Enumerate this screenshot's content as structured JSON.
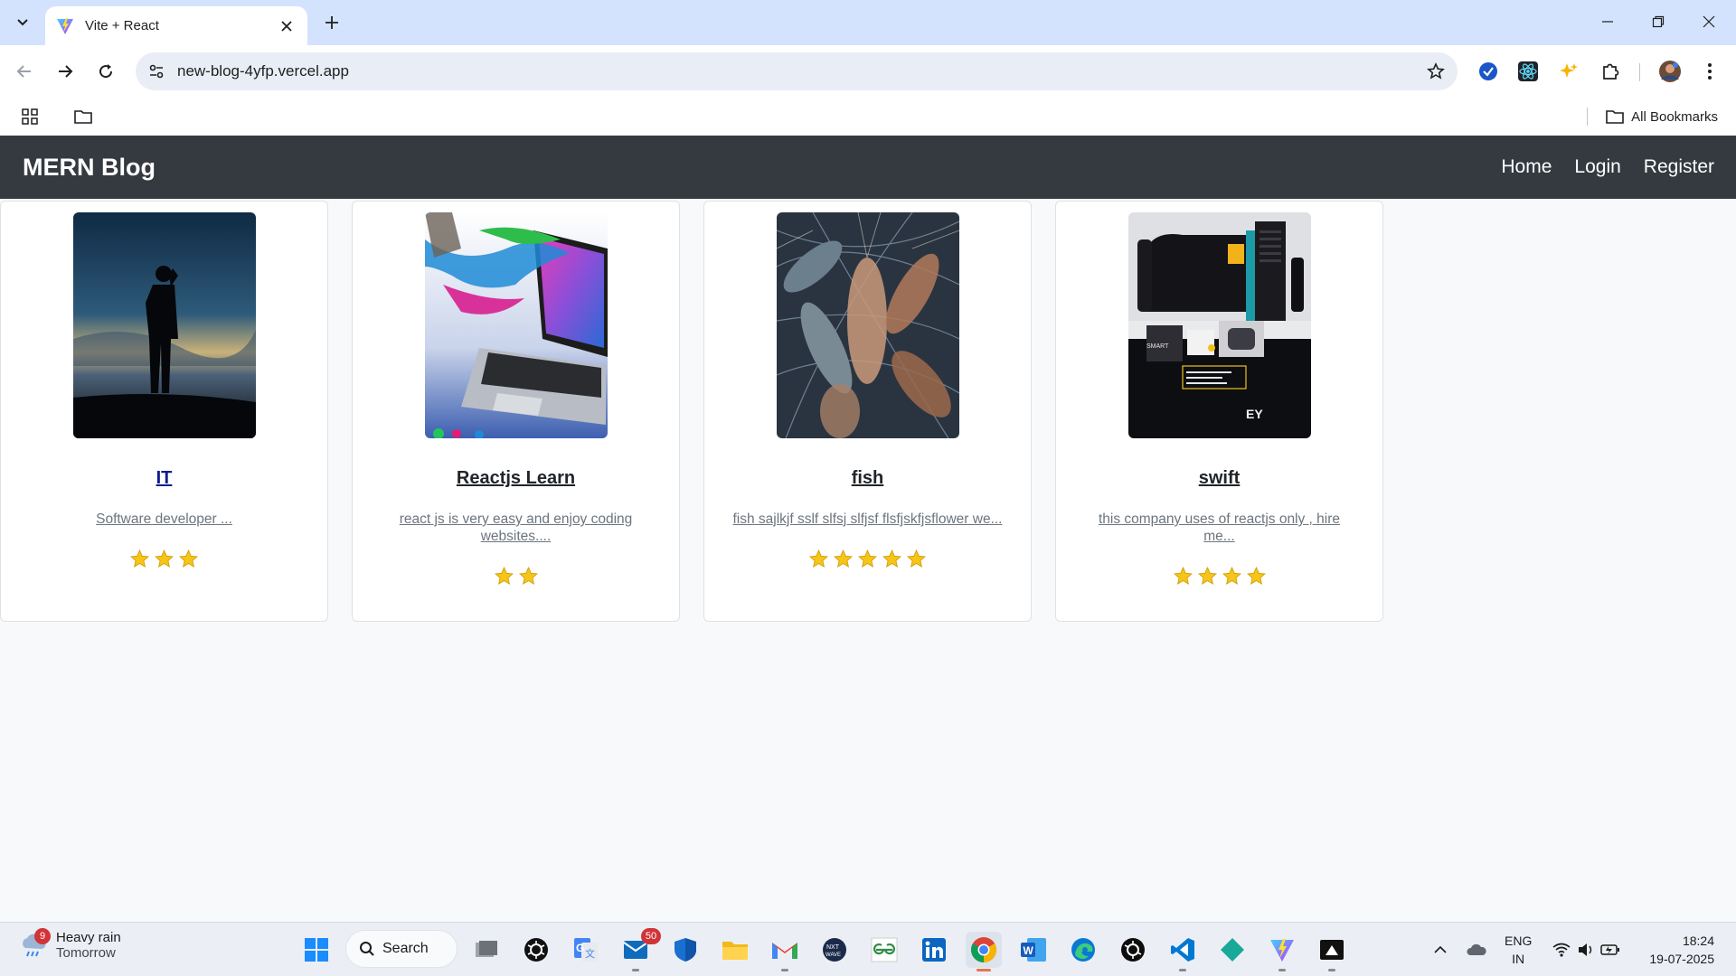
{
  "browser": {
    "tab_title": "Vite + React",
    "url": "new-blog-4yfp.vercel.app",
    "all_bookmarks_label": "All Bookmarks"
  },
  "app": {
    "brand": "MERN Blog",
    "nav": {
      "home": "Home",
      "login": "Login",
      "register": "Register"
    }
  },
  "posts": [
    {
      "title": "IT",
      "description": "Software developer ...",
      "rating": 3,
      "image": "silhouette-sunset"
    },
    {
      "title": "Reactjs Learn",
      "description": "react js is very easy and enjoy coding websites....",
      "rating": 2,
      "image": "laptop-paint-splash"
    },
    {
      "title": "fish",
      "description": "fish sajlkjf sslf slfsj slfjsf flsfjskfjsflower we...",
      "rating": 5,
      "image": "shrimps"
    },
    {
      "title": "swift",
      "description": "this company uses of reactjs only , hire me...",
      "rating": 4,
      "image": "laptop-bag-goodies"
    }
  ],
  "taskbar": {
    "weather_badge": "9",
    "weather_title": "Heavy rain",
    "weather_sub": "Tomorrow",
    "search_label": "Search",
    "mail_badge": "50",
    "lang_top": "ENG",
    "lang_bottom": "IN",
    "time": "18:24",
    "date": "19-07-2025"
  },
  "colors": {
    "navbar": "#343a40",
    "star": "#f5c518",
    "tabstrip": "#d3e3fd"
  }
}
